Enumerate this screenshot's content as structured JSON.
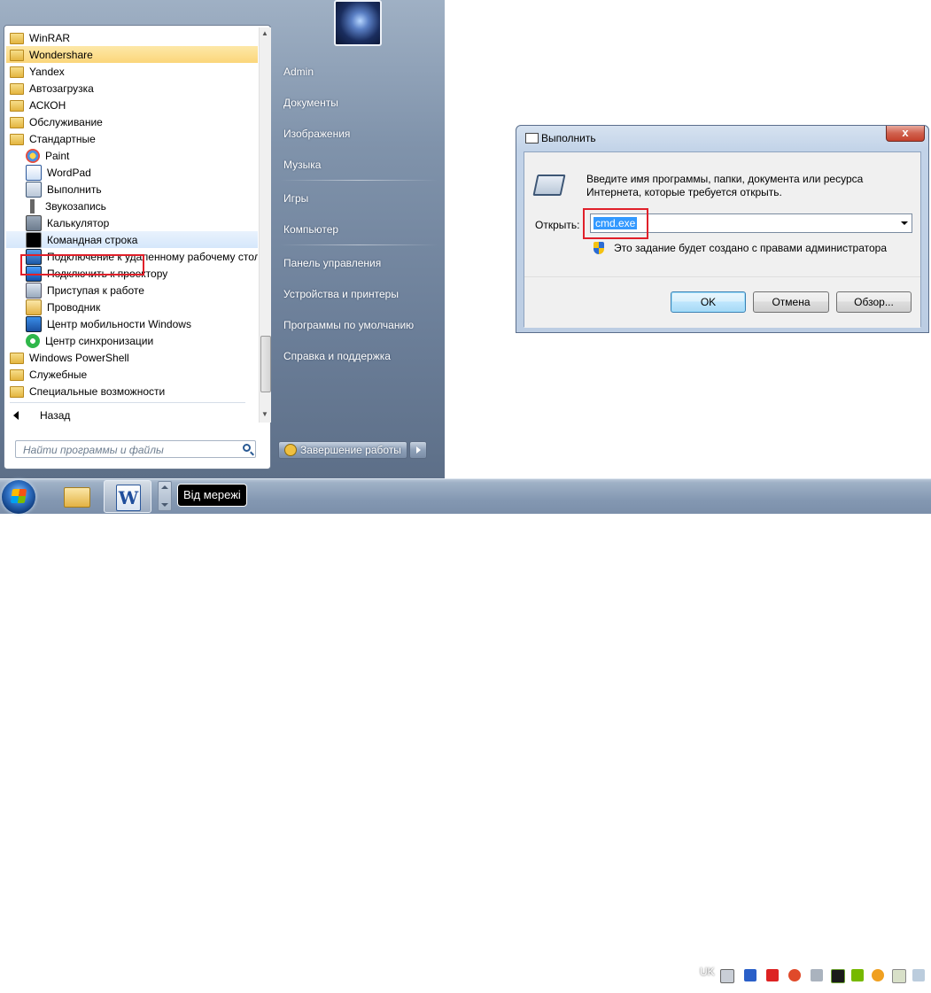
{
  "start_menu": {
    "programs": [
      {
        "label": "WinRAR",
        "icon": "folder-icon",
        "state": "normal"
      },
      {
        "label": "Wondershare",
        "icon": "folder-icon",
        "state": "highlighted"
      },
      {
        "label": "Yandex",
        "icon": "folder-icon",
        "state": "normal"
      },
      {
        "label": "Автозагрузка",
        "icon": "folder-icon",
        "state": "normal"
      },
      {
        "label": "АСКОН",
        "icon": "folder-icon",
        "state": "normal"
      },
      {
        "label": "Обслуживание",
        "icon": "folder-icon",
        "state": "normal"
      },
      {
        "label": "Стандартные",
        "icon": "folder-icon",
        "state": "normal"
      },
      {
        "label": "Paint",
        "icon": "paint-icon",
        "state": "normal"
      },
      {
        "label": "WordPad",
        "icon": "wordpad-icon",
        "state": "normal"
      },
      {
        "label": "Выполнить",
        "icon": "run-icon",
        "state": "normal"
      },
      {
        "label": "Звукозапись",
        "icon": "microphone-icon",
        "state": "normal"
      },
      {
        "label": "Калькулятор",
        "icon": "calculator-icon",
        "state": "normal"
      },
      {
        "label": "Командная строка",
        "icon": "cmd-icon",
        "state": "selected"
      },
      {
        "label": "Подключение к удаленному рабочему столу",
        "icon": "remote-desktop-icon",
        "state": "normal"
      },
      {
        "label": "Подключить к проектору",
        "icon": "projector-icon",
        "state": "normal"
      },
      {
        "label": "Приступая к работе",
        "icon": "getting-started-icon",
        "state": "normal"
      },
      {
        "label": "Проводник",
        "icon": "explorer-icon",
        "state": "normal"
      },
      {
        "label": "Центр мобильности Windows",
        "icon": "mobility-center-icon",
        "state": "normal"
      },
      {
        "label": "Центр синхронизации",
        "icon": "sync-center-icon",
        "state": "normal"
      },
      {
        "label": "Windows PowerShell",
        "icon": "folder-icon",
        "state": "normal"
      },
      {
        "label": "Служебные",
        "icon": "folder-icon",
        "state": "normal"
      },
      {
        "label": "Специальные возможности",
        "icon": "folder-icon",
        "state": "normal"
      }
    ],
    "back_label": "Назад",
    "search_placeholder": "Найти программы и файлы",
    "right_items": [
      "Admin",
      "Документы",
      "Изображения",
      "Музыка",
      "Игры",
      "Компьютер",
      "Панель управления",
      "Устройства и принтеры",
      "Программы по умолчанию",
      "Справка и поддержка"
    ],
    "shutdown_label": "Завершение работы"
  },
  "run_dialog": {
    "title": "Выполнить",
    "close_glyph": "x",
    "description": "Введите имя программы, папки, документа или ресурса Интернета, которые требуется открыть.",
    "open_label": "Открыть:",
    "open_value": "cmd.exe",
    "admin_note": "Это задание будет создано с правами администратора",
    "ok_label": "OK",
    "cancel_label": "Отмена",
    "browse_label": "Обзор..."
  },
  "taskbar": {
    "tooltip": "Від мережі",
    "language": "UK",
    "pinned": [
      "windows-explorer-icon",
      "word-icon"
    ]
  },
  "colors": {
    "highlight_box": "#e0202a",
    "selection_blue": "#3399ff",
    "folder_highlight": "#fbd67a"
  }
}
